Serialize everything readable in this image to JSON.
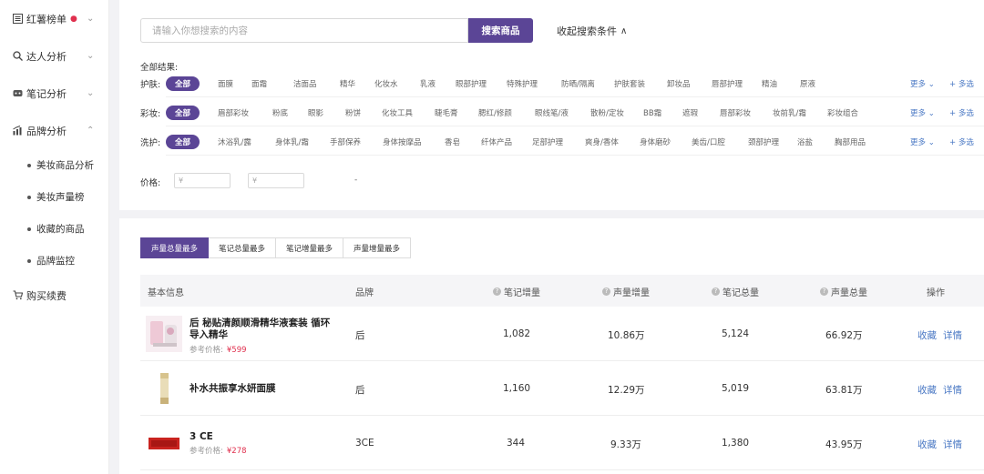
{
  "sidebar": {
    "items": [
      {
        "label": "红薯榜单",
        "icon": "list-icon",
        "has_dot": true
      },
      {
        "label": "达人分析",
        "icon": "search-icon"
      },
      {
        "label": "笔记分析",
        "icon": "note-icon"
      },
      {
        "label": "品牌分析",
        "icon": "bar-chart-icon",
        "expanded": true
      }
    ],
    "sub_items": [
      "美妆商品分析",
      "美妆声量榜",
      "收藏的商品",
      "品牌监控"
    ],
    "purchase_label": "购买续费"
  },
  "search": {
    "placeholder": "请输入你想搜索的内容",
    "button_label": "搜索商品",
    "collapse_label": "收起搜索条件"
  },
  "filters": {
    "all_results_label": "全部结果:",
    "more_label": "更多",
    "multi_label": "+ 多选",
    "rows": [
      {
        "label": "护肤:",
        "all": "全部",
        "tags": [
          "面膜",
          "面霜",
          "洁面品",
          "精华",
          "化妆水",
          "乳液",
          "眼部护理",
          "特殊护理",
          "防晒/隔离",
          "护肤套装",
          "卸妆品",
          "唇部护理",
          "精油",
          "原液"
        ]
      },
      {
        "label": "彩妆:",
        "all": "全部",
        "tags": [
          "眉部彩妆",
          "粉底",
          "眼影",
          "粉饼",
          "化妆工具",
          "睫毛膏",
          "腮红/修颜",
          "眼线笔/液",
          "散粉/定妆",
          "BB霜",
          "遮瑕",
          "唇部彩妆",
          "妆前乳/霜",
          "彩妆组合"
        ]
      },
      {
        "label": "洗护:",
        "all": "全部",
        "tags": [
          "沐浴乳/露",
          "身体乳/霜",
          "手部保养",
          "身体按摩品",
          "香皂",
          "纤体产品",
          "足部护理",
          "爽身/香体",
          "身体磨砂",
          "美齿/口腔",
          "颈部护理",
          "浴盐",
          "胸部用品"
        ]
      }
    ],
    "price_label": "价格:",
    "price_min_placeholder": "¥",
    "price_max_placeholder": "¥",
    "price_dash": "-"
  },
  "sort_tabs": [
    "声量总量最多",
    "笔记总量最多",
    "笔记增量最多",
    "声量增量最多"
  ],
  "table": {
    "headers": {
      "basic": "基本信息",
      "brand": "品牌",
      "note_inc": "笔记增量",
      "voice_inc": "声量增量",
      "note_total": "笔记总量",
      "voice_total": "声量总量",
      "ops": "操作"
    },
    "ref_price_label": "参考价格:",
    "collect_label": "收藏",
    "detail_label": "详情",
    "rows": [
      {
        "name_line1": "后 秘贴清颜顺滑精华液套装 循环",
        "name_line2": "导入精华",
        "price": "¥599",
        "brand": "后",
        "note_inc": "1,082",
        "voice_inc": "10.86万",
        "note_total": "5,124",
        "voice_total": "66.92万"
      },
      {
        "name_line1": "补水共振享水妍面膜",
        "name_line2": "",
        "price": "",
        "brand": "后",
        "note_inc": "1,160",
        "voice_inc": "12.29万",
        "note_total": "5,019",
        "voice_total": "63.81万"
      },
      {
        "name_line1": "3 CE",
        "name_line2": "",
        "price": "¥278",
        "brand": "3CE",
        "note_inc": "344",
        "voice_inc": "9.33万",
        "note_total": "1,380",
        "voice_total": "43.95万"
      }
    ]
  },
  "colors": {
    "accent": "#5b4596",
    "link": "#4a78c4",
    "price": "#e0304e"
  }
}
